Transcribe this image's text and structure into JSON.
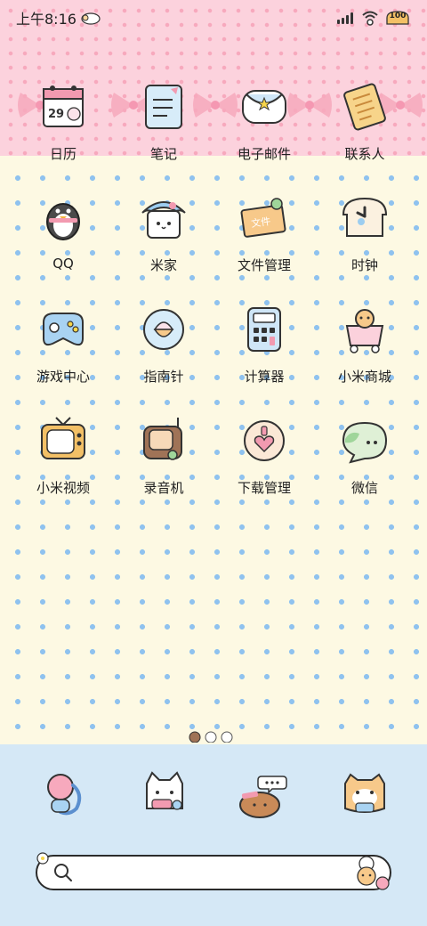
{
  "status_bar": {
    "time": "上午8:16",
    "battery_level": "100"
  },
  "apps": [
    {
      "label": "日历",
      "icon": "calendar-icon",
      "calendar_day": "29"
    },
    {
      "label": "笔记",
      "icon": "notes-icon"
    },
    {
      "label": "电子邮件",
      "icon": "email-icon"
    },
    {
      "label": "联系人",
      "icon": "contacts-icon"
    },
    {
      "label": "QQ",
      "icon": "penguin-icon"
    },
    {
      "label": "米家",
      "icon": "mijia-icon"
    },
    {
      "label": "文件管理",
      "icon": "file-manager-icon",
      "icon_text": "文件"
    },
    {
      "label": "时钟",
      "icon": "clock-icon"
    },
    {
      "label": "游戏中心",
      "icon": "gamepad-icon"
    },
    {
      "label": "指南针",
      "icon": "compass-icon"
    },
    {
      "label": "计算器",
      "icon": "calculator-icon"
    },
    {
      "label": "小米商城",
      "icon": "shopping-cart-icon"
    },
    {
      "label": "小米视频",
      "icon": "tv-icon"
    },
    {
      "label": "录音机",
      "icon": "recorder-icon"
    },
    {
      "label": "下载管理",
      "icon": "download-icon"
    },
    {
      "label": "微信",
      "icon": "wechat-icon"
    }
  ],
  "dock": [
    {
      "icon": "phone-icon"
    },
    {
      "icon": "cat-message-icon"
    },
    {
      "icon": "bread-browser-icon"
    },
    {
      "icon": "hamster-camera-icon"
    }
  ],
  "search": {
    "placeholder": ""
  },
  "colors": {
    "pink_band": "#fcd2dd",
    "dot_blue": "#8fc2ef",
    "cream": "#fdf9e3",
    "dock_blue": "#d5e8f6"
  }
}
